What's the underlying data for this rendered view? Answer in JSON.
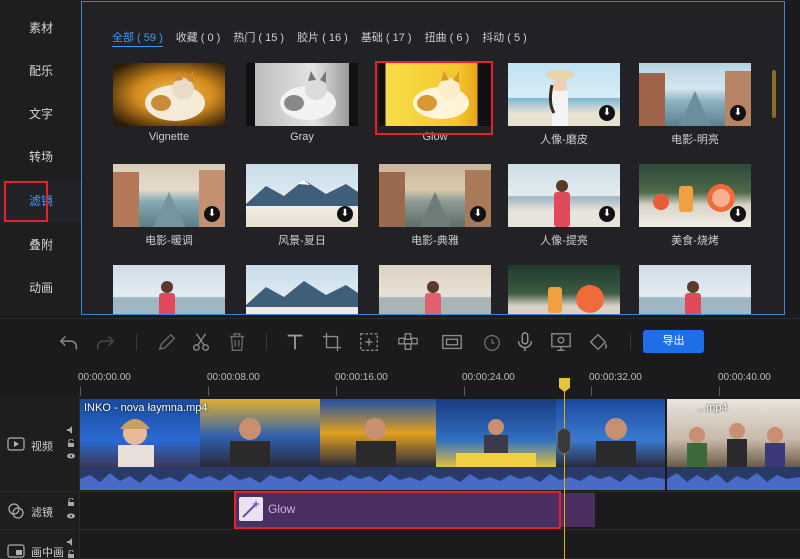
{
  "sidebar": {
    "items": [
      {
        "label": "素材"
      },
      {
        "label": "配乐"
      },
      {
        "label": "文字"
      },
      {
        "label": "转场"
      },
      {
        "label": "滤镜"
      },
      {
        "label": "叠附"
      },
      {
        "label": "动画"
      }
    ],
    "active_index": 4
  },
  "filters": {
    "tabs": [
      {
        "label": "全部 ( 59 )"
      },
      {
        "label": "收藏 ( 0 )"
      },
      {
        "label": "热门 ( 15 )"
      },
      {
        "label": "胶片 ( 16 )"
      },
      {
        "label": "基础 ( 17 )"
      },
      {
        "label": "扭曲 ( 6 )"
      },
      {
        "label": "抖动 ( 5 )"
      }
    ],
    "items": [
      {
        "label": "Vignette",
        "download": false
      },
      {
        "label": "Gray",
        "download": false
      },
      {
        "label": "Glow",
        "download": false,
        "selected": true
      },
      {
        "label": "人像-磨皮",
        "download": true
      },
      {
        "label": "电影-明亮",
        "download": true
      },
      {
        "label": "电影-暖调",
        "download": true
      },
      {
        "label": "风景-夏日",
        "download": true
      },
      {
        "label": "电影-典雅",
        "download": true
      },
      {
        "label": "人像-提亮",
        "download": true
      },
      {
        "label": "美食-烧烤",
        "download": true
      },
      {
        "label": "",
        "download": false
      },
      {
        "label": "",
        "download": false
      },
      {
        "label": "",
        "download": false
      },
      {
        "label": "",
        "download": false
      },
      {
        "label": "",
        "download": false
      }
    ]
  },
  "toolbar": {
    "export_label": "导出",
    "tools": [
      "undo-icon",
      "redo-icon",
      "pencil-icon",
      "scissors-icon",
      "trash-icon",
      "text-icon",
      "crop-icon",
      "add-frame-icon",
      "mosaic-icon",
      "frame-icon",
      "timer-icon",
      "microphone-icon",
      "screen-record-icon",
      "paint-bucket-icon"
    ]
  },
  "timeline": {
    "ruler": [
      "00:00:00.00",
      "00:00:08.00",
      "00:00:16.00",
      "00:00:24.00",
      "00:00:32.00",
      "00:00:40.00"
    ],
    "tracks": [
      {
        "name": "视频"
      },
      {
        "name": "滤镜"
      },
      {
        "name": "画中画"
      }
    ],
    "video_clip_title": "INKO - nova łaymna.mp4",
    "second_clip_title": "...mp4",
    "filter_clip_label": "Glow"
  },
  "colors": {
    "accent": "#3a9bff",
    "highlight_box": "#e8202a",
    "export_button": "#1e6ee8",
    "playhead": "#e0b400",
    "filter_clip": "#4b2e62"
  }
}
